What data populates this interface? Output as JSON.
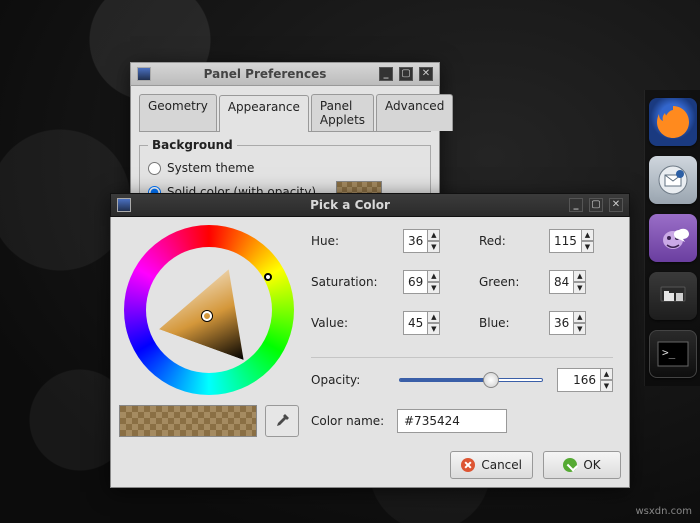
{
  "prefs": {
    "title": "Panel Preferences",
    "tabs": [
      "Geometry",
      "Appearance",
      "Panel Applets",
      "Advanced"
    ],
    "active_tab": 1,
    "bg_legend": "Background",
    "sys_theme": "System theme",
    "solid_color": "Solid color (with opacity)"
  },
  "picker": {
    "title": "Pick a Color",
    "labels": {
      "hue": "Hue:",
      "sat": "Saturation:",
      "val": "Value:",
      "red": "Red:",
      "green": "Green:",
      "blue": "Blue:",
      "opacity": "Opacity:",
      "colorname": "Color name:"
    },
    "values": {
      "hue": "36",
      "sat": "69",
      "val": "45",
      "red": "115",
      "green": "84",
      "blue": "36",
      "opacity": "166",
      "hex": "#735424"
    },
    "cancel": "Cancel",
    "ok": "OK"
  },
  "dock": {
    "items": [
      "firefox",
      "mail",
      "pidgin",
      "files",
      "terminal"
    ]
  },
  "watermark": "wsxdn.com"
}
